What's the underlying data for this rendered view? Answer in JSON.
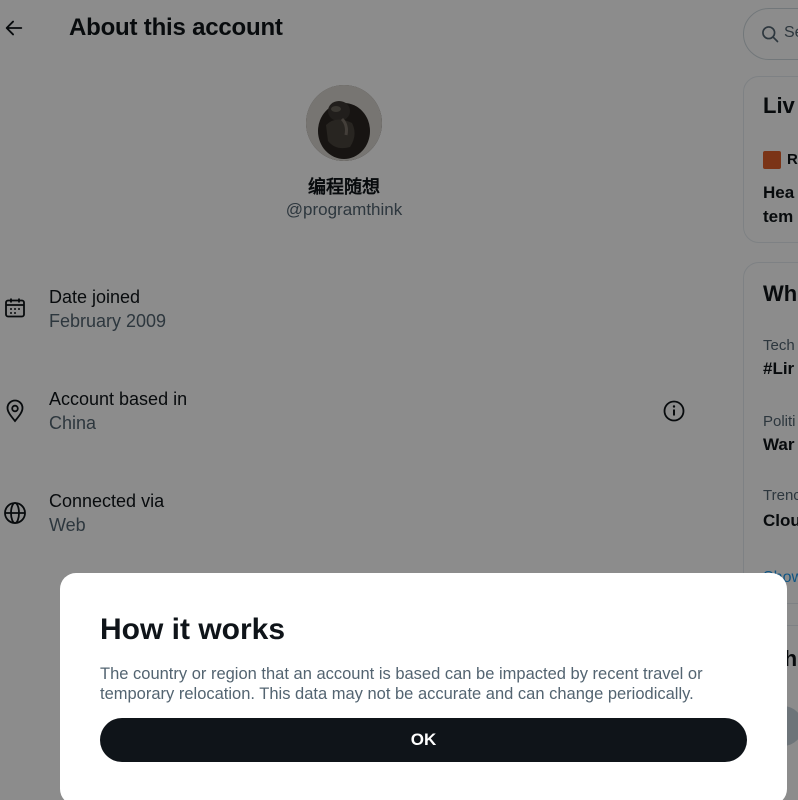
{
  "header": {
    "back_icon": "arrow-left-icon",
    "title": "About this account"
  },
  "profile": {
    "display_name": "编程随想",
    "handle": "@programthink"
  },
  "info_rows": [
    {
      "icon": "calendar-icon",
      "label": "Date joined",
      "value": "February 2009"
    },
    {
      "icon": "location-pin-icon",
      "label": "Account based in",
      "value": "China",
      "help_icon": "info-circle-icon"
    },
    {
      "icon": "globe-icon",
      "label": "Connected via",
      "value": "Web"
    }
  ],
  "sidebar": {
    "search_placeholder": "Se",
    "live_card": {
      "title": "Liv",
      "source": "R",
      "headline_line1": "Hea",
      "headline_line2": "tem"
    },
    "trends_card": {
      "title": "Wh",
      "items": [
        {
          "category": "Tech",
          "topic": "#Lir"
        },
        {
          "category": "Politi",
          "topic": "War"
        },
        {
          "category": "Trenc",
          "topic": "Clou"
        }
      ],
      "show_more": "Show"
    },
    "who_to_follow_title": "Wh"
  },
  "modal": {
    "title": "How it works",
    "body": "The country or region that an account is based can be impacted by recent travel or temporary relocation. This data may not be accurate and can change periodically.",
    "ok_label": "OK"
  },
  "colors": {
    "text_primary": "#0f1419",
    "text_secondary": "#536471",
    "overlay": "rgba(0,0,0,0.45)",
    "button_bg": "#0f1419",
    "link": "#1d9bf0"
  }
}
